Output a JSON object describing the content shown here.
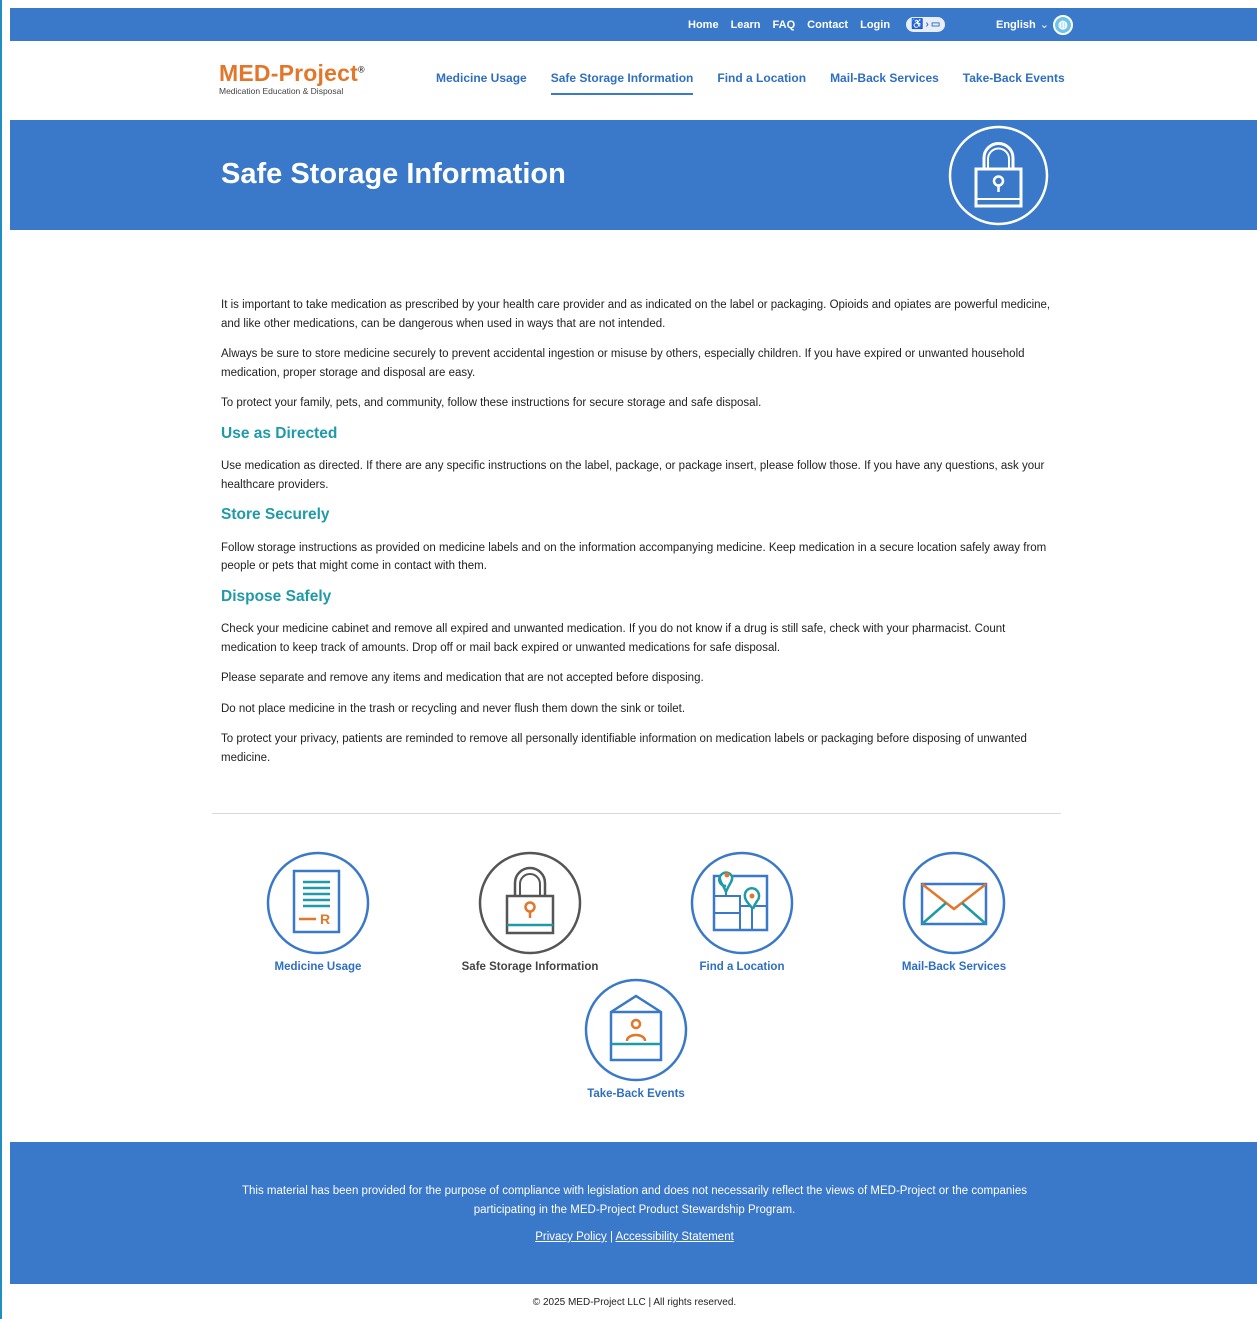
{
  "utility_bar": {
    "links": [
      "Home",
      "Learn",
      "FAQ",
      "Contact",
      "Login"
    ],
    "accessibility_toggle_icon": "wheelchair-toggle-icon",
    "language": "English",
    "language_chevron": "⌄",
    "globe_icon": "globe-icon"
  },
  "logo": {
    "name": "MED-Project",
    "mark": "®",
    "tagline": "Medication Education & Disposal"
  },
  "nav": {
    "items": [
      "Medicine Usage",
      "Safe Storage Information",
      "Find a Location",
      "Mail-Back Services",
      "Take-Back Events"
    ],
    "active": "Safe Storage Information"
  },
  "hero": {
    "title": "Safe Storage Information",
    "icon": "padlock-icon"
  },
  "content": {
    "intro": [
      "It is important to take medication as prescribed by your health care provider and as indicated on the label or packaging. Opioids and opiates are powerful medicine, and like other medications, can be dangerous when used in ways that are not intended.",
      "Always be sure to store medicine securely to prevent accidental ingestion or misuse by others, especially children. If you have expired or unwanted household medication, proper storage and disposal are easy.",
      "To protect your family, pets, and community, follow these instructions for secure storage and safe disposal."
    ],
    "sections": [
      {
        "heading": "Use as Directed",
        "paragraphs": [
          "Use medication as directed. If there are any specific instructions on the label, package, or package insert, please follow those. If you have any questions, ask your healthcare providers."
        ]
      },
      {
        "heading": "Store Securely",
        "paragraphs": [
          "Follow storage instructions as provided on medicine labels and on the information accompanying medicine. Keep medication in a secure location safely away from people or pets that might come in contact with them."
        ]
      },
      {
        "heading": "Dispose Safely",
        "paragraphs": [
          "Check your medicine cabinet and remove all expired and unwanted medication. If you do not know if a drug is still safe, check with your pharmacist. Count medication to keep track of amounts. Drop off or mail back expired or unwanted medications for safe disposal.",
          "Please separate and remove any items and medication that are not accepted before disposing.",
          "Do not place medicine in the trash or recycling and never flush them down the sink or toilet.",
          "To protect your privacy, patients are reminded to remove all personally identifiable information on medication labels or packaging before disposing of unwanted medicine."
        ]
      }
    ]
  },
  "icon_nav": [
    {
      "label": "Medicine Usage",
      "icon": "prescription-document-icon"
    },
    {
      "label": "Safe Storage Information",
      "icon": "padlock-icon"
    },
    {
      "label": "Find a Location",
      "icon": "map-pin-icon"
    },
    {
      "label": "Mail-Back Services",
      "icon": "envelope-icon"
    },
    {
      "label": "Take-Back Events",
      "icon": "kiosk-person-icon"
    }
  ],
  "footer": {
    "note": "This material has been provided for the purpose of compliance with legislation and does not necessarily reflect the views of MED-Project or the companies participating in the MED-Project Product Stewardship Program.",
    "privacy": "Privacy Policy",
    "separator": "|",
    "accessibility": "Accessibility Statement",
    "copyright": "© 2025 MED-Project LLC | All rights reserved."
  },
  "colors": {
    "brand_blue": "#3a78c9",
    "logo_orange": "#e2772b",
    "heading_teal": "#1f9aa8",
    "nav_blue": "#2f6fc1"
  }
}
